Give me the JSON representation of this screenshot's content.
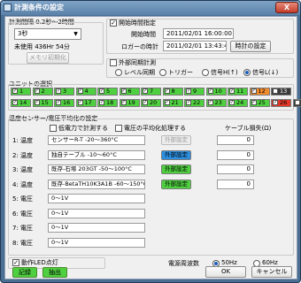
{
  "window": {
    "title": "計測条件の設定",
    "close_label": "X"
  },
  "interval": {
    "caption": "計測間隔 0.2秒～2時間",
    "selected": "3秒",
    "unused": "未使用 436Hr 54分",
    "memory_init": "メモリ初期化"
  },
  "start_time": {
    "checkbox_label": "開始時間指定",
    "checked": true,
    "start_label": "開始時間",
    "start_value": "2011/02/01 16:00:00",
    "logger_label": "ロガーの時計",
    "logger_value": "2011/02/01 13:43:42",
    "set_clock_button": "時計の設定"
  },
  "external_sync": {
    "checkbox_label": "外部同期計測",
    "options": [
      {
        "label": "レベル同期",
        "selected": false
      },
      {
        "label": "トリガー",
        "selected": false
      },
      {
        "label": "信号H(↑)",
        "selected": false
      },
      {
        "label": "信号L(↓)",
        "selected": true
      }
    ]
  },
  "units": {
    "caption": "ユニットの選択",
    "items": [
      {
        "num": "1",
        "color": "#4fd040",
        "checked": true
      },
      {
        "num": "2",
        "color": "#4fd040",
        "checked": true
      },
      {
        "num": "3",
        "color": "#4fd040",
        "checked": true
      },
      {
        "num": "4",
        "color": "#4fd040",
        "checked": true
      },
      {
        "num": "5",
        "color": "#4fd040",
        "checked": true
      },
      {
        "num": "6",
        "color": "#4fd040",
        "checked": true
      },
      {
        "num": "7",
        "color": "#4fd040",
        "checked": true
      },
      {
        "num": "8",
        "color": "#4fd040",
        "checked": true
      },
      {
        "num": "9",
        "color": "#4fd040",
        "checked": true
      },
      {
        "num": "10",
        "color": "#4fd040",
        "checked": true
      },
      {
        "num": "11",
        "color": "#4fd040",
        "checked": true
      },
      {
        "num": "12",
        "color": "#f08a2a",
        "checked": true
      },
      {
        "num": "13",
        "color": "#3a3a3a",
        "checked": false
      },
      {
        "num": "14",
        "color": "#4fd040",
        "checked": true
      },
      {
        "num": "15",
        "color": "#4fd040",
        "checked": true
      },
      {
        "num": "16",
        "color": "#4fd040",
        "checked": true
      },
      {
        "num": "17",
        "color": "#4fd040",
        "checked": true
      },
      {
        "num": "18",
        "color": "#4fd040",
        "checked": true
      },
      {
        "num": "19",
        "color": "#4fd040",
        "checked": true
      },
      {
        "num": "20",
        "color": "#4fd040",
        "checked": true
      },
      {
        "num": "21",
        "color": "#4fd040",
        "checked": true
      },
      {
        "num": "22",
        "color": "#4fd040",
        "checked": true
      },
      {
        "num": "23",
        "color": "#4fd040",
        "checked": true
      },
      {
        "num": "24",
        "color": "#4fd040",
        "checked": true
      },
      {
        "num": "25",
        "color": "#4fd040",
        "checked": true
      },
      {
        "num": "26",
        "color": "#e0382a",
        "checked": true
      },
      {
        "num": "27",
        "color": "#3a3a3a",
        "checked": false
      }
    ]
  },
  "sensors": {
    "caption": "温度センサー/電圧平均化の設定",
    "low_power_label": "低電力で計測する",
    "voltage_avg_label": "電圧の平均化処理する",
    "cable_header": "ケーブル損失(Ω)",
    "rows": [
      {
        "name": "1: 温度",
        "sensor": "センサーR-T -20～360°C",
        "ext": "外部設定",
        "ext_state": "disabled",
        "cable": "0"
      },
      {
        "name": "2: 温度",
        "sensor": "独自テーブル -10～60°C",
        "ext": "外部設定",
        "ext_state": "blue",
        "cable": "0"
      },
      {
        "name": "3: 温度",
        "sensor": "既存-石塚 203GT -50～100°C",
        "ext": "外部設定",
        "ext_state": "green",
        "cable": "0"
      },
      {
        "name": "4: 温度",
        "sensor": "既存-BetaTH10K3A1B -60～150°C",
        "ext": "外部設定",
        "ext_state": "green",
        "cable": "0"
      },
      {
        "name": "5: 電圧",
        "sensor": "0～1V",
        "ext": "",
        "ext_state": "none",
        "cable": ""
      },
      {
        "name": "6: 電圧",
        "sensor": "0～1V",
        "ext": "",
        "ext_state": "none",
        "cable": ""
      },
      {
        "name": "7: 電圧",
        "sensor": "0～1V",
        "ext": "",
        "ext_state": "none",
        "cable": ""
      },
      {
        "name": "8: 電圧",
        "sensor": "0～1V",
        "ext": "",
        "ext_state": "none",
        "cable": ""
      }
    ]
  },
  "bottom": {
    "led_label": "動作LED点灯",
    "led_checked": true,
    "power_freq_label": "電源周波数",
    "freq_options": [
      {
        "label": "50Hz",
        "selected": true
      },
      {
        "label": "60Hz",
        "selected": false
      }
    ],
    "record_button": "記録",
    "extract_button": "抽出",
    "ok_button": "OK",
    "cancel_button": "キャンセル"
  },
  "colors": {
    "title_bar": "#5b81a8",
    "unit_active": "#4fd040",
    "ext_blue": "#2d8fe0",
    "ext_green": "#4fd040"
  }
}
